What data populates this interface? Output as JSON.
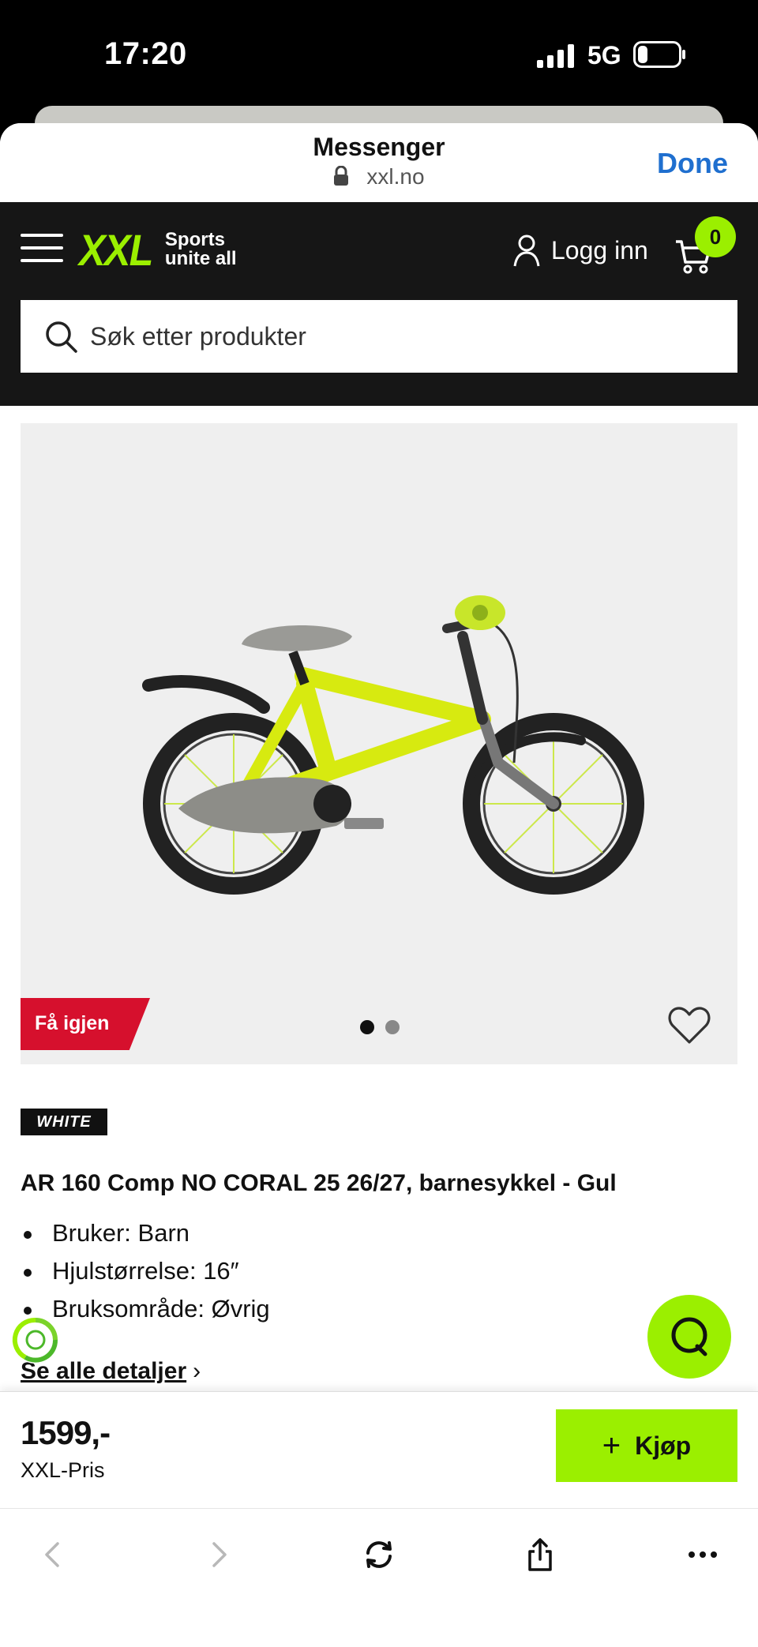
{
  "status_bar": {
    "time": "17:20",
    "network": "5G"
  },
  "sheet_header": {
    "title": "Messenger",
    "url": "xxl.no",
    "done_label": "Done"
  },
  "site_header": {
    "logo": "XXL",
    "logo_tagline_line1": "Sports",
    "logo_tagline_line2": "unite all",
    "login_label": "Logg inn",
    "cart_count": "0",
    "search_placeholder": "Søk etter produkter"
  },
  "product": {
    "promo_badge": "Få igjen",
    "image_count": 2,
    "active_image": 1,
    "brand": "WHITE",
    "title": "AR 160 Comp NO CORAL 25 26/27, barnesykkel - Gul",
    "specs": [
      "Bruker: Barn",
      "Hjulstørrelse: 16″",
      "Bruksområde: Øvrig"
    ],
    "details_link": "Se alle detaljer",
    "price": "1599,-",
    "price_label": "XXL-Pris",
    "buy_label": "Kjøp"
  },
  "colors": {
    "brand_green": "#9bef00",
    "header_bg": "#161616",
    "promo_red": "#d6102d",
    "link_blue": "#1f6fcf"
  },
  "icons": [
    "signal-icon",
    "battery-icon",
    "lock-icon",
    "menu-icon",
    "user-icon",
    "cart-icon",
    "search-icon",
    "heart-icon",
    "eco-icon",
    "chat-icon",
    "back-icon",
    "forward-icon",
    "reload-icon",
    "share-icon",
    "more-icon"
  ]
}
